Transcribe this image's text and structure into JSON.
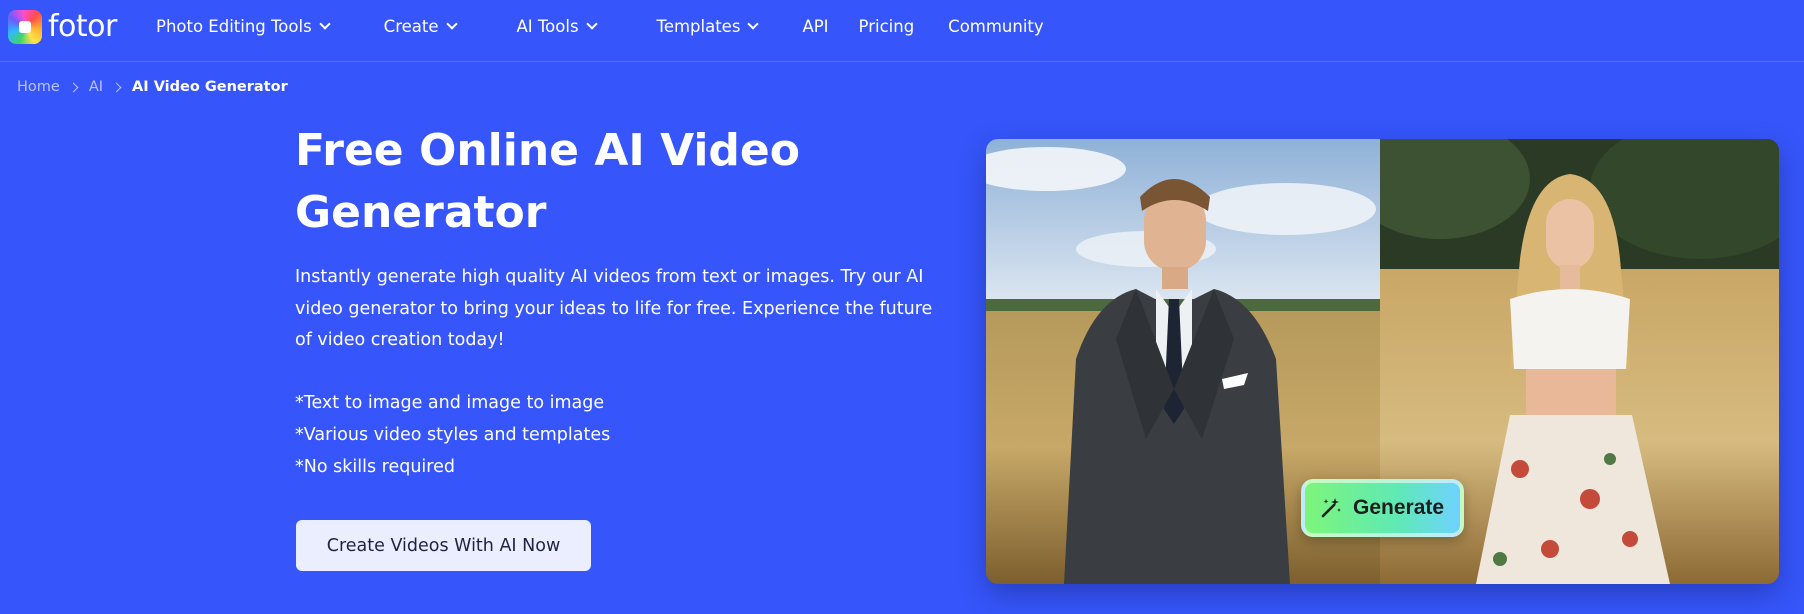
{
  "brand": {
    "name": "fotor"
  },
  "nav": {
    "items": [
      {
        "label": "Photo Editing Tools",
        "has_dropdown": true
      },
      {
        "label": "Create",
        "has_dropdown": true
      },
      {
        "label": "AI Tools",
        "has_dropdown": true
      },
      {
        "label": "Templates",
        "has_dropdown": true
      },
      {
        "label": "API",
        "has_dropdown": false
      },
      {
        "label": "Pricing",
        "has_dropdown": false
      },
      {
        "label": "Community",
        "has_dropdown": false
      }
    ]
  },
  "breadcrumb": {
    "items": [
      "Home",
      "AI"
    ],
    "current": "AI Video Generator"
  },
  "hero": {
    "title": "Free Online AI Video Generator",
    "description": "Instantly generate high quality AI videos from text or images. Try our AI video generator to bring your ideas to life for free. Experience the future of video creation today!",
    "features": [
      "*Text to image and image to image",
      "*Various video styles and templates",
      "*No skills required"
    ],
    "cta_label": "Create Videos With AI Now",
    "generate_label": "Generate"
  },
  "colors": {
    "background": "#3656fb",
    "cta_background": "#eaeeff",
    "generate_gradient_start": "#7df57a",
    "generate_gradient_end": "#6fd2ff"
  },
  "icons": {
    "logo": "fotor-logo-icon",
    "dropdown": "chevron-down-icon",
    "breadcrumb_separator": "chevron-right-icon",
    "generate": "magic-wand-icon"
  }
}
